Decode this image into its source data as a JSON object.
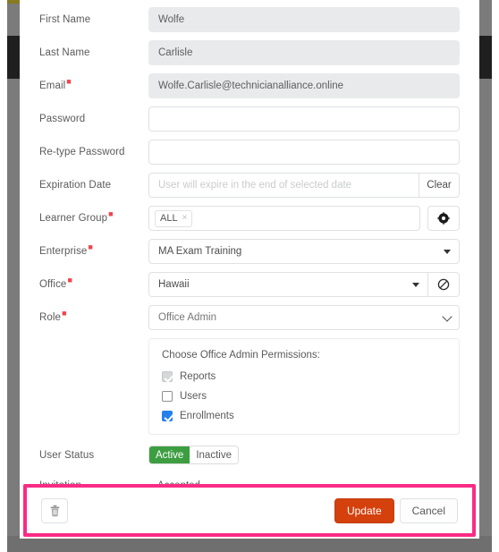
{
  "form": {
    "fields": [
      {
        "label": "First Name",
        "required": false,
        "value": "Wolfe",
        "placeholder": "",
        "state": "disabled"
      },
      {
        "label": "Last Name",
        "required": false,
        "value": "Carlisle",
        "placeholder": "",
        "state": "disabled"
      },
      {
        "label": "Email",
        "required": true,
        "value": "Wolfe.Carlisle@technicianalliance.online",
        "placeholder": "",
        "state": "disabled"
      },
      {
        "label": "Password",
        "required": false,
        "value": "",
        "placeholder": "",
        "state": "enabled"
      },
      {
        "label": "Re-type Password",
        "required": false,
        "value": "",
        "placeholder": "",
        "state": "enabled"
      }
    ],
    "expiration": {
      "label": "Expiration Date",
      "required": false,
      "value": "",
      "placeholder": "User will expire in the end of selected date",
      "clear_label": "Clear"
    },
    "learner_group": {
      "label": "Learner Group",
      "required": true,
      "tags": [
        {
          "text": "ALL",
          "remove": "×"
        }
      ],
      "add_icon": "target-circle-icon"
    },
    "enterprise": {
      "label": "Enterprise",
      "required": true,
      "value": "MA Exam Training"
    },
    "office": {
      "label": "Office",
      "required": true,
      "value": "Hawaii",
      "block_icon": "ban-circle-icon"
    },
    "role": {
      "label": "Role",
      "required": true,
      "value": "Office Admin",
      "options": [
        "Office Admin"
      ]
    },
    "permissions": {
      "title": "Choose Office Admin Permissions:",
      "items": [
        {
          "label": "Reports",
          "checked": true,
          "disabled": true
        },
        {
          "label": "Users",
          "checked": false,
          "disabled": false
        },
        {
          "label": "Enrollments",
          "checked": true,
          "disabled": false
        }
      ]
    },
    "user_status": {
      "label": "User Status",
      "active_label": "Active",
      "inactive_label": "Inactive",
      "selected": "Active"
    },
    "invitation": {
      "label": "Invitation",
      "value": "Accepted"
    }
  },
  "footer": {
    "delete_icon": "trash-icon",
    "update_label": "Update",
    "cancel_label": "Cancel"
  },
  "colors": {
    "accent_primary": "#d4410d",
    "status_active": "#3d9e41",
    "checkbox_checked": "#2680eb",
    "required_mark": "#f0444b",
    "highlight_box": "#fa2b84",
    "disabled_field_bg": "#e9eaec"
  }
}
